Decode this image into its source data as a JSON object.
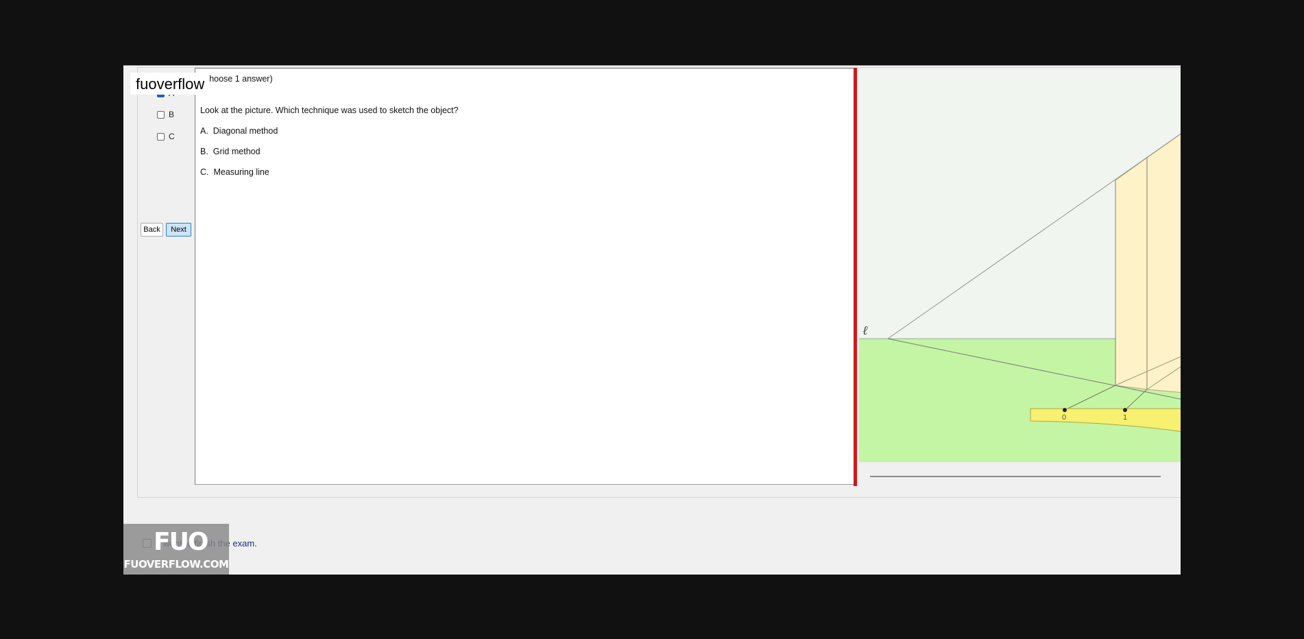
{
  "logo_text": "fuoverflow",
  "answer_options": [
    {
      "label": "A",
      "checked": true
    },
    {
      "label": "B",
      "checked": false
    },
    {
      "label": "C",
      "checked": false
    }
  ],
  "nav": {
    "back_label": "Back",
    "next_label": "Next"
  },
  "question": {
    "instruction": "(Choose 1 answer)",
    "prompt": "Look at the picture. Which technique was used to sketch the object?",
    "choices": [
      {
        "letter": "A.",
        "text": "Diagonal method"
      },
      {
        "letter": "B.",
        "text": "Grid method"
      },
      {
        "letter": "C.",
        "text": "Measuring line"
      }
    ]
  },
  "figure": {
    "line_label": "ℓ",
    "scale_labels": [
      "0",
      "1"
    ],
    "colors": {
      "sky": "#f1f5ef",
      "ground": "#c4f5a4",
      "object": "#fdf2c8",
      "scale": "#f7f070"
    }
  },
  "finish": {
    "label": "I want to finish the exam."
  },
  "watermark": {
    "mark": "FUO",
    "site": "FUOVERFLOW.COM"
  },
  "colors": {
    "divider": "#d01818",
    "background": "#111111",
    "window": "#f0f0f0"
  }
}
